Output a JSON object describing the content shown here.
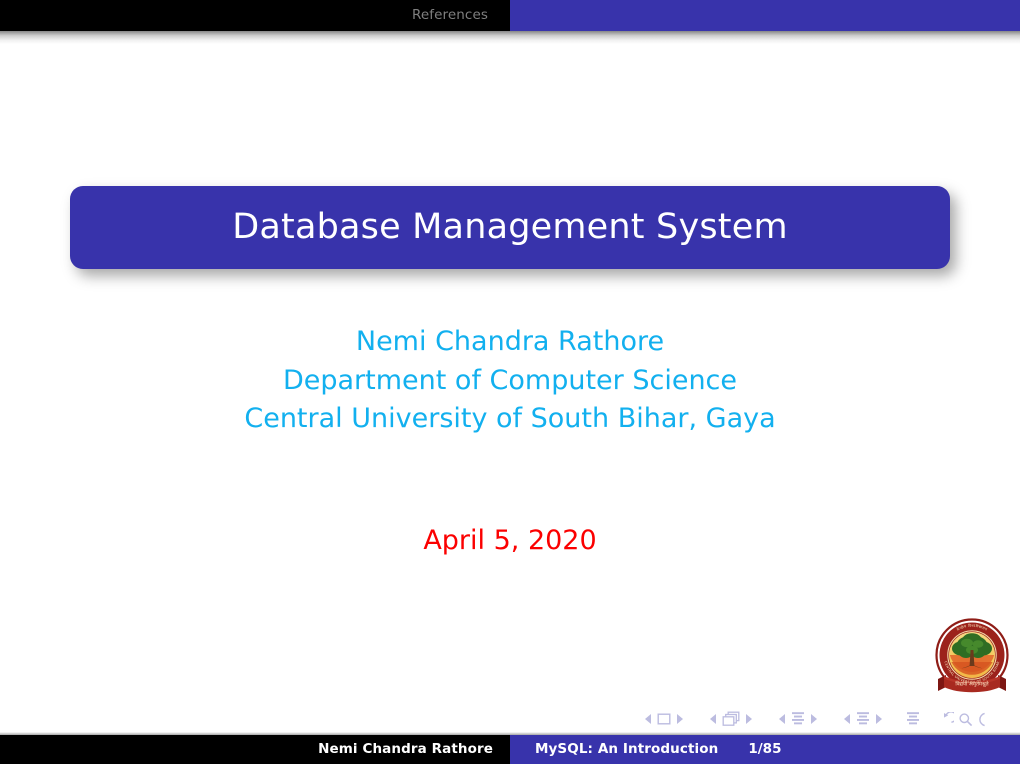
{
  "slide": {
    "header": {
      "section_label": "References"
    },
    "title": "Database Management System",
    "author_lines": [
      "Nemi Chandra Rathore",
      "Department of Computer Science",
      "Central University of South Bihar, Gaya"
    ],
    "date": "April 5, 2020",
    "logo": {
      "name": "central-university-of-south-bihar-emblem",
      "ring_top_text": "केन्द्रीय विश्वविद्यालय",
      "ring_bottom_text": "CENTRAL UNIVERSITY OF SOUTH BIHAR",
      "ribbon_text": "विद्यया अमृतमश्नुते"
    },
    "navigation_symbols": [
      {
        "name": "slide-nav",
        "prev": "◀",
        "icon": "slide-icon",
        "next": "▶"
      },
      {
        "name": "frame-nav",
        "prev": "◀",
        "icon": "frames-stack-icon",
        "next": "▶"
      },
      {
        "name": "subsection-nav",
        "prev": "◀",
        "icon": "subsection-icon",
        "next": "▶"
      },
      {
        "name": "section-nav",
        "prev": "◀",
        "icon": "section-icon",
        "next": "▶"
      },
      {
        "name": "document-nav",
        "icon": "document-icon"
      },
      {
        "name": "back-nav",
        "icon": "back-arrow-icon"
      },
      {
        "name": "find-nav",
        "icon": "magnifier-icon"
      },
      {
        "name": "goto-nav",
        "icon": "goto-icon"
      }
    ],
    "footer": {
      "author": "Nemi Chandra Rathore",
      "short_title": "MySQL: An Introduction",
      "page": "1/85"
    },
    "colors": {
      "structure_blue": "#3833ab",
      "header_black": "#000000",
      "header_label_gray": "#7f7f7f",
      "author_cyan": "#12b0ef",
      "date_red": "#fb0000",
      "title_text_white": "#ffffff",
      "nav_symbol_lavender": "#bcbce0",
      "background_white": "#ffffff"
    }
  }
}
